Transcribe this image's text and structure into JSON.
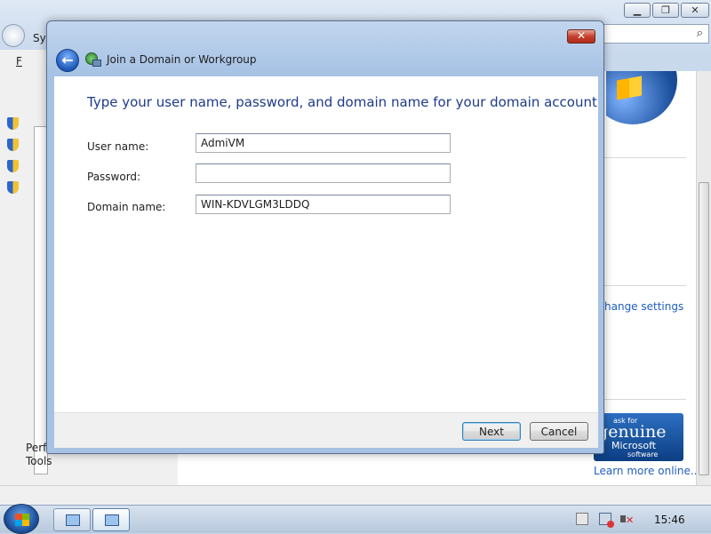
{
  "background_window": {
    "address_label": "Sys",
    "menu_file": "F",
    "left_text": "Perf\nTools",
    "change_settings_link": "hange settings",
    "genuine": {
      "ask": "ask for",
      "genuine": "genuine",
      "microsoft": "Microsoft",
      "software": "software"
    },
    "learn_more_link": "Learn more online..."
  },
  "dialog": {
    "title": "Join a Domain or Workgroup",
    "heading": "Type your user name, password, and domain name for your domain account",
    "fields": {
      "username": {
        "label": "User name:",
        "value": "AdmiVM"
      },
      "password": {
        "label": "Password:",
        "value": ""
      },
      "domain": {
        "label": "Domain name:",
        "value": "WIN-KDVLGM3LDDQ"
      }
    },
    "buttons": {
      "next": "Next",
      "cancel": "Cancel"
    }
  },
  "taskbar": {
    "clock": "15:46"
  },
  "icons": {
    "back": "back-arrow-icon",
    "network": "network-join-icon",
    "close": "close-icon",
    "shield": "uac-shield-icon",
    "search": "search-icon"
  }
}
